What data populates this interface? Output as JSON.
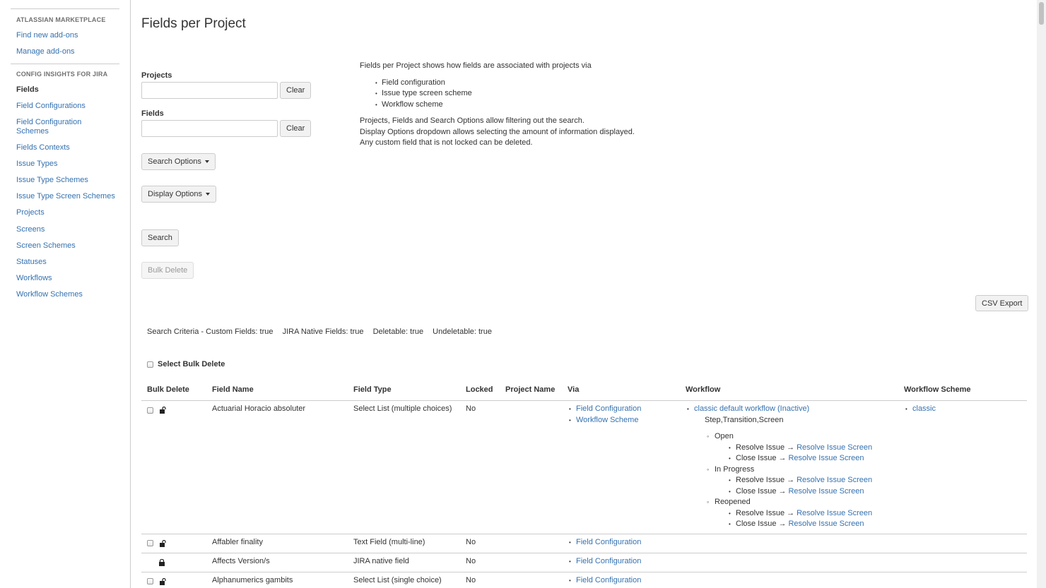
{
  "sidebar": {
    "section1": "ATLASSIAN MARKETPLACE",
    "items1": [
      {
        "label": "Find new add-ons"
      },
      {
        "label": "Manage add-ons"
      }
    ],
    "section2": "CONFIG INSIGHTS FOR JIRA",
    "items2": [
      {
        "label": "Fields",
        "active": true
      },
      {
        "label": "Field Configurations"
      },
      {
        "label": "Field Configuration Schemes"
      },
      {
        "label": "Fields Contexts"
      },
      {
        "label": "Issue Types"
      },
      {
        "label": "Issue Type Schemes"
      },
      {
        "label": "Issue Type Screen Schemes"
      },
      {
        "label": "Projects"
      },
      {
        "label": "Screens"
      },
      {
        "label": "Screen Schemes"
      },
      {
        "label": "Statuses"
      },
      {
        "label": "Workflows"
      },
      {
        "label": "Workflow Schemes"
      }
    ]
  },
  "page_title": "Fields per Project",
  "form": {
    "projects_label": "Projects",
    "projects_value": "",
    "fields_label": "Fields",
    "fields_value": "",
    "clear_label": "Clear",
    "search_options_label": "Search Options",
    "display_options_label": "Display Options",
    "search_label": "Search",
    "bulk_delete_label": "Bulk Delete",
    "csv_export_label": "CSV Export"
  },
  "info": {
    "intro": "Fields per Project shows how fields are associated with projects via",
    "bullets": [
      "Field configuration",
      "Issue type screen scheme",
      "Workflow scheme"
    ],
    "line1": "Projects, Fields and Search Options allow filtering out the search.",
    "line2": "Display Options dropdown allows selecting the amount of information displayed.",
    "line3": "Any custom field that is not locked can be deleted."
  },
  "criteria": {
    "custom": "Search Criteria - Custom Fields: true",
    "native": "JIRA Native Fields: true",
    "deletable": "Deletable: true",
    "undeletable": "Undeletable: true"
  },
  "select_bulk_delete": "Select Bulk Delete",
  "table": {
    "headers": {
      "bulk_delete": "Bulk Delete",
      "field_name": "Field Name",
      "field_type": "Field Type",
      "locked": "Locked",
      "project_name": "Project Name",
      "via": "Via",
      "workflow": "Workflow",
      "workflow_scheme": "Workflow Scheme"
    },
    "rows": [
      {
        "name": "Actuarial Horacio absoluter",
        "type": "Select List (multiple choices)",
        "locked": "No",
        "via": [
          "Field Configuration",
          "Workflow Scheme"
        ],
        "workflow": {
          "name": "classic default workflow (Inactive)",
          "elements": "Step,Transition,Screen",
          "steps": [
            {
              "name": "Open",
              "transitions": [
                {
                  "name": "Resolve Issue",
                  "screen": "Resolve Issue Screen"
                },
                {
                  "name": "Close Issue",
                  "screen": "Resolve Issue Screen"
                }
              ]
            },
            {
              "name": "In Progress",
              "transitions": [
                {
                  "name": "Resolve Issue",
                  "screen": "Resolve Issue Screen"
                },
                {
                  "name": "Close Issue",
                  "screen": "Resolve Issue Screen"
                }
              ]
            },
            {
              "name": "Reopened",
              "transitions": [
                {
                  "name": "Resolve Issue",
                  "screen": "Resolve Issue Screen"
                },
                {
                  "name": "Close Issue",
                  "screen": "Resolve Issue Screen"
                }
              ]
            }
          ]
        },
        "workflow_scheme": "classic"
      },
      {
        "name": "Affabler finality",
        "type": "Text Field (multi-line)",
        "locked": "No",
        "via": [
          "Field Configuration"
        ]
      },
      {
        "name": "Affects Version/s",
        "type": "JIRA native field",
        "locked": "No",
        "via": [
          "Field Configuration"
        ]
      },
      {
        "name": "Alphanumerics gambits",
        "type": "Select List (single choice)",
        "locked": "No",
        "via": [
          "Field Configuration"
        ]
      }
    ]
  },
  "icons": {
    "unlocked": "lock-open-icon",
    "locked": "lock-closed-icon"
  },
  "colors": {
    "link": "#3572b0",
    "text": "#333333",
    "border": "#cccccc",
    "button_bg": "#f2f2f2"
  }
}
